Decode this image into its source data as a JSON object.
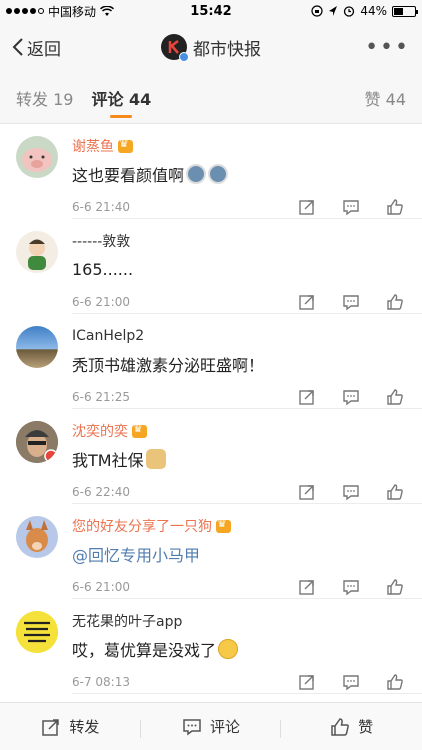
{
  "status": {
    "carrier": "中国移动",
    "time": "15:42",
    "battery": "44%",
    "battery_level": 0.44
  },
  "nav": {
    "back_label": "返回",
    "title": "都市快报"
  },
  "tabs": {
    "repost": "转发 19",
    "comments": "评论 44",
    "likes": "赞 44"
  },
  "comments": [
    {
      "name": "谢蒸鱼",
      "text": "这也要看颜值啊",
      "time": "6-6 21:40"
    },
    {
      "name": "------敦敦",
      "text": "165......",
      "time": "6-6 21:00"
    },
    {
      "name": "ICanHelp2",
      "text": "秃顶书雄激素分泌旺盛啊！",
      "time": "6-6 21:25"
    },
    {
      "name": "沈奕的奕",
      "text": "我TM社保",
      "time": "6-6 22:40"
    },
    {
      "name": "您的好友分享了一只狗",
      "text": "@回忆专用小马甲",
      "time": "6-6 21:00"
    },
    {
      "name": "无花果的叶子app",
      "text": "哎，葛优算是没戏了",
      "time": "6-7 08:13"
    }
  ],
  "bottom": {
    "repost": "转发",
    "comment": "评论",
    "like": "赞"
  },
  "colors": {
    "accent": "#f7891c",
    "vip_name": "#eb7350",
    "mention": "#507daf"
  }
}
